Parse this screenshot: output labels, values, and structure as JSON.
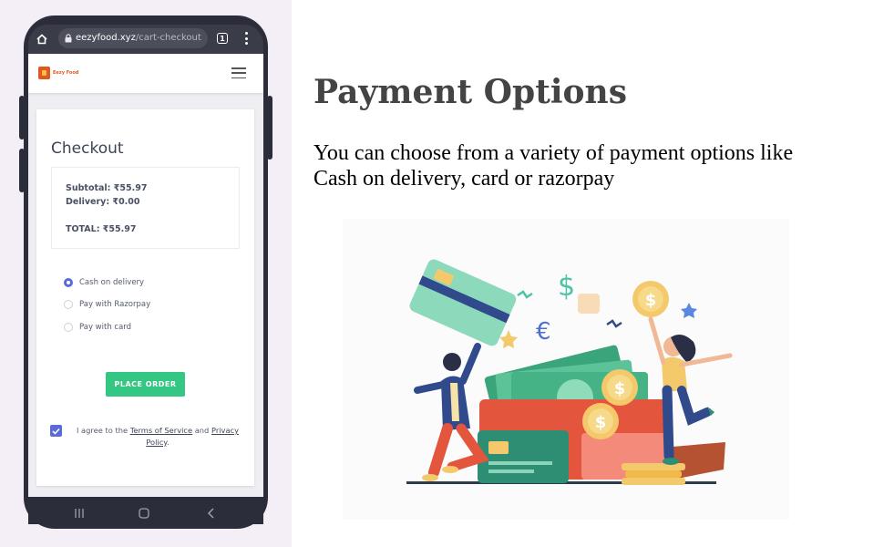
{
  "browser": {
    "url_host": "eezyfood.xyz",
    "url_path": "/cart-checkout",
    "tab_count": "1"
  },
  "site": {
    "logo_text": "Eezy Food"
  },
  "checkout": {
    "title": "Checkout",
    "subtotal": "Subtotal: ₹55.97",
    "delivery": "Delivery: ₹0.00",
    "total": "TOTAL: ₹55.97",
    "payment_options": [
      {
        "label": "Cash on delivery",
        "selected": true
      },
      {
        "label": "Pay with Razorpay",
        "selected": false
      },
      {
        "label": "Pay with card",
        "selected": false
      }
    ],
    "place_order_label": "PLACE ORDER",
    "agree": {
      "prefix": "I agree to the ",
      "terms_link": "Terms of Service",
      "middle": " and ",
      "privacy_link": "Privacy Policy",
      "suffix": ".",
      "checked": true
    }
  },
  "slide": {
    "heading": "Payment Options",
    "description": "You can choose from a variety of payment options like Cash on delivery, card or razorpay"
  },
  "colors": {
    "accent": "#5a6ad8",
    "button_green": "#34c784",
    "phone_frame": "#2b2d3a",
    "panel_bg": "#f4eff7"
  }
}
